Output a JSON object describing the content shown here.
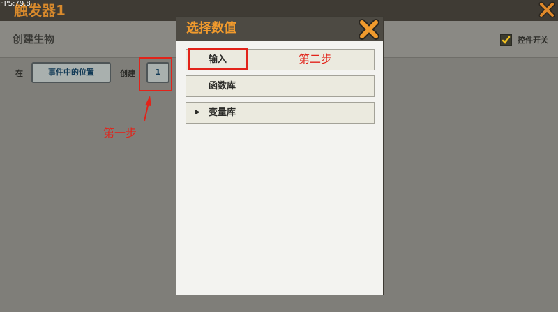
{
  "overlay": {
    "fps": "FPS:79.8",
    "trigger_title": "触发器1"
  },
  "page": {
    "subtitle": "创建生物",
    "toggle_label": "控件开关",
    "toggle_checked": true,
    "row": {
      "at_label": "在",
      "location_button": "事件中的位置",
      "create_label": "创建",
      "count_value": "1"
    }
  },
  "modal": {
    "title": "选择数值",
    "options": [
      {
        "label": "输入"
      },
      {
        "label": "函数库"
      },
      {
        "label": "变量库",
        "expandable": true
      }
    ]
  },
  "annotations": {
    "step1": "第一步",
    "step2": "第二步",
    "color": "#e2231a"
  },
  "colors": {
    "accent_orange": "#f09a2d",
    "header_dark": "#4d4a43"
  }
}
